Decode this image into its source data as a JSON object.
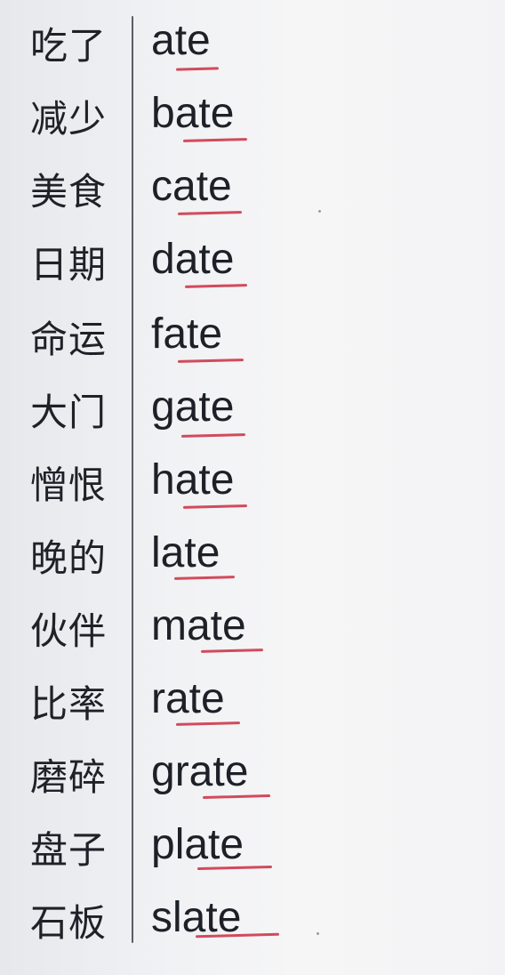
{
  "vocab": [
    {
      "cn": "吃了",
      "en": "ate"
    },
    {
      "cn": "减少",
      "en": "bate"
    },
    {
      "cn": "美食",
      "en": "cate"
    },
    {
      "cn": "日期",
      "en": "date"
    },
    {
      "cn": "命运",
      "en": "fate"
    },
    {
      "cn": "大门",
      "en": "gate"
    },
    {
      "cn": "憎恨",
      "en": "hate"
    },
    {
      "cn": "晚的",
      "en": "late"
    },
    {
      "cn": "伙伴",
      "en": "mate"
    },
    {
      "cn": "比率",
      "en": "rate"
    },
    {
      "cn": "磨碎",
      "en": "grate"
    },
    {
      "cn": "盘子",
      "en": "plate"
    },
    {
      "cn": "石板",
      "en": "slate"
    }
  ],
  "colors": {
    "text": "#1e2027",
    "underline": "#d24a5c",
    "divider": "#5a5d66"
  }
}
